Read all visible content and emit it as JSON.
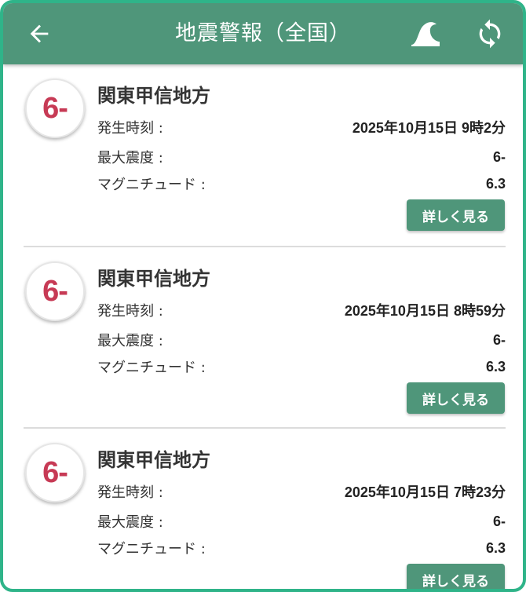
{
  "header": {
    "title": "地震警報（全国）",
    "back_icon": "arrow-left-icon",
    "tsunami_icon": "wave-icon",
    "refresh_icon": "refresh-icon",
    "background": "#4f967a"
  },
  "quakes": [
    {
      "intensity_badge": "6-",
      "region": "関東甲信地方",
      "time_label": "発生時刻 :",
      "time_value": "2025年10月15日 9時2分",
      "max_label": "最大震度 :",
      "max_value": "6-",
      "mag_label": "マグニチュード :",
      "mag_value": "6.3",
      "button": "詳しく見る"
    },
    {
      "intensity_badge": "6-",
      "region": "関東甲信地方",
      "time_label": "発生時刻 :",
      "time_value": "2025年10月15日 8時59分",
      "max_label": "最大震度 :",
      "max_value": "6-",
      "mag_label": "マグニチュード :",
      "mag_value": "6.3",
      "button": "詳しく見る"
    },
    {
      "intensity_badge": "6-",
      "region": "関東甲信地方",
      "time_label": "発生時刻 :",
      "time_value": "2025年10月15日 7時23分",
      "max_label": "最大震度 :",
      "max_value": "6-",
      "mag_label": "マグニチュード :",
      "mag_value": "6.3",
      "button": "詳しく見る"
    }
  ],
  "colors": {
    "accent": "#4f967a",
    "frame": "#2fb489",
    "intensity": "#c73a55"
  }
}
